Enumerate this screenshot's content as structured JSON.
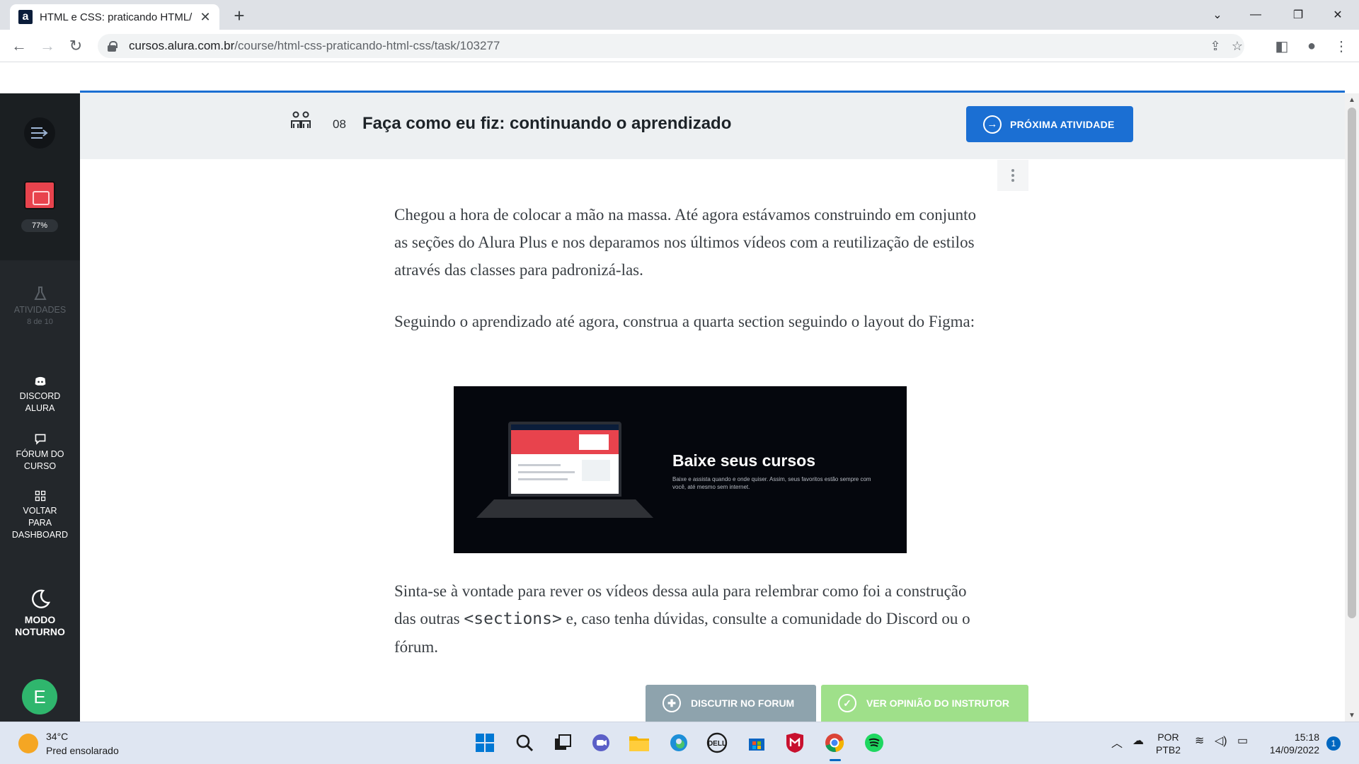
{
  "browser": {
    "tab_title": "HTML e CSS: praticando HTML/C",
    "favicon_letter": "a",
    "url_domain": "cursos.alura.com.br",
    "url_path": "/course/html-css-praticando-html-css/task/103277"
  },
  "sidebar": {
    "course_progress": "77%",
    "activities_label": "ATIVIDADES",
    "activities_count": "8 de 10",
    "discord_line1": "DISCORD",
    "discord_line2": "ALURA",
    "forum_line1": "FÓRUM DO",
    "forum_line2": "CURSO",
    "dashboard_line1": "VOLTAR",
    "dashboard_line2": "PARA",
    "dashboard_line3": "DASHBOARD",
    "night_line1": "MODO",
    "night_line2": "NOTURNO",
    "avatar_initial": "E"
  },
  "lesson": {
    "number": "08",
    "title": "Faça como eu fiz: continuando o aprendizado",
    "next_button": "PRÓXIMA ATIVIDADE"
  },
  "article": {
    "p1": "Chegou a hora de colocar a mão na massa. Até agora estávamos construindo em conjunto as seções do Alura Plus e nos deparamos nos últimos vídeos com a reutilização de estilos através das classes para padronizá-las.",
    "p2": "Seguindo o aprendizado até agora, construa a quarta section seguindo o layout do Figma:",
    "image_title": "Baixe seus cursos",
    "image_subtitle": "Baixe e assista quando e onde quiser. Assim, seus favoritos estão sempre com você, até mesmo sem internet.",
    "p3_before": "Sinta-se à vontade para rever os vídeos dessa aula para relembrar como foi a construção das outras ",
    "p3_code": "<sections>",
    "p3_after": " e, caso tenha dúvidas, consulte a comunidade do Discord ou o fórum."
  },
  "actions": {
    "forum_button": "DISCUTIR NO FORUM",
    "opinion_button": "VER OPINIÃO DO INSTRUTOR"
  },
  "taskbar": {
    "temperature": "34°C",
    "weather": "Pred ensolarado",
    "lang_line1": "POR",
    "lang_line2": "PTB2",
    "time": "15:18",
    "date": "14/09/2022",
    "notifications": "1"
  },
  "colors": {
    "accent_blue": "#1b6fd3",
    "sidebar_bg": "#23272b",
    "forum_btn": "#8ea3ad",
    "opinion_btn": "#9fe08a"
  }
}
